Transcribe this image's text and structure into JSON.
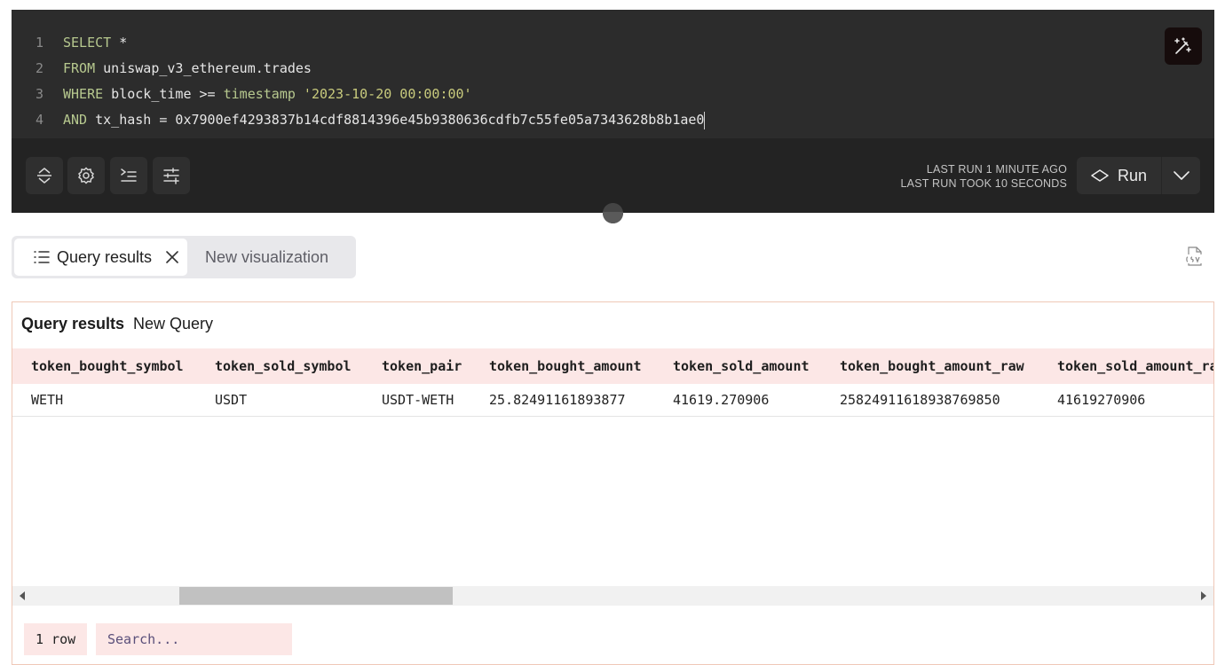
{
  "editor": {
    "line_numbers": [
      "1",
      "2",
      "3",
      "4"
    ],
    "line1": {
      "kw": "SELECT",
      "rest": " *"
    },
    "line2": {
      "kw": "FROM",
      "rest": " uniswap_v3_ethereum.trades"
    },
    "line3": {
      "kw": "WHERE",
      "col": " block_time >= ",
      "fn": "timestamp",
      "str": " '2023-10-20 00:00:00'"
    },
    "line4": {
      "kw": "AND",
      "rest": " tx_hash = 0x7900ef4293837b14cdf8814396e45b9380636cdfb7c55fe05a7343628b8b1ae0"
    }
  },
  "toolbar": {
    "last_run": "LAST RUN 1 MINUTE AGO",
    "last_run_took": "LAST RUN TOOK 10 SECONDS",
    "run_label": "Run"
  },
  "tabs": {
    "active_label": "Query results",
    "new_label": "New visualization"
  },
  "results": {
    "title": "Query results",
    "subtitle": "New Query",
    "columns": [
      "token_bought_symbol",
      "token_sold_symbol",
      "token_pair",
      "token_bought_amount",
      "token_sold_amount",
      "token_bought_amount_raw",
      "token_sold_amount_raw"
    ],
    "rows": [
      [
        "WETH",
        "USDT",
        "USDT-WETH",
        "25.82491161893877",
        "41619.270906",
        "25824911618938769850",
        "41619270906"
      ]
    ],
    "row_count": "1 row",
    "search_placeholder": "Search..."
  },
  "colors": {
    "editor_bg": "#2c2c2c",
    "toolbar_bg": "#232323",
    "keyword": "#b7c98f",
    "string": "#c9cb7d",
    "table_header_bg": "#fce7e6",
    "results_border": "#efc8b7"
  },
  "icons": [
    "magic-wand-icon",
    "expand-collapse-icon",
    "gear-icon",
    "indent-icon",
    "sliders-icon",
    "run-icon",
    "chevron-down-icon",
    "list-icon",
    "close-icon",
    "csv-download-icon"
  ]
}
